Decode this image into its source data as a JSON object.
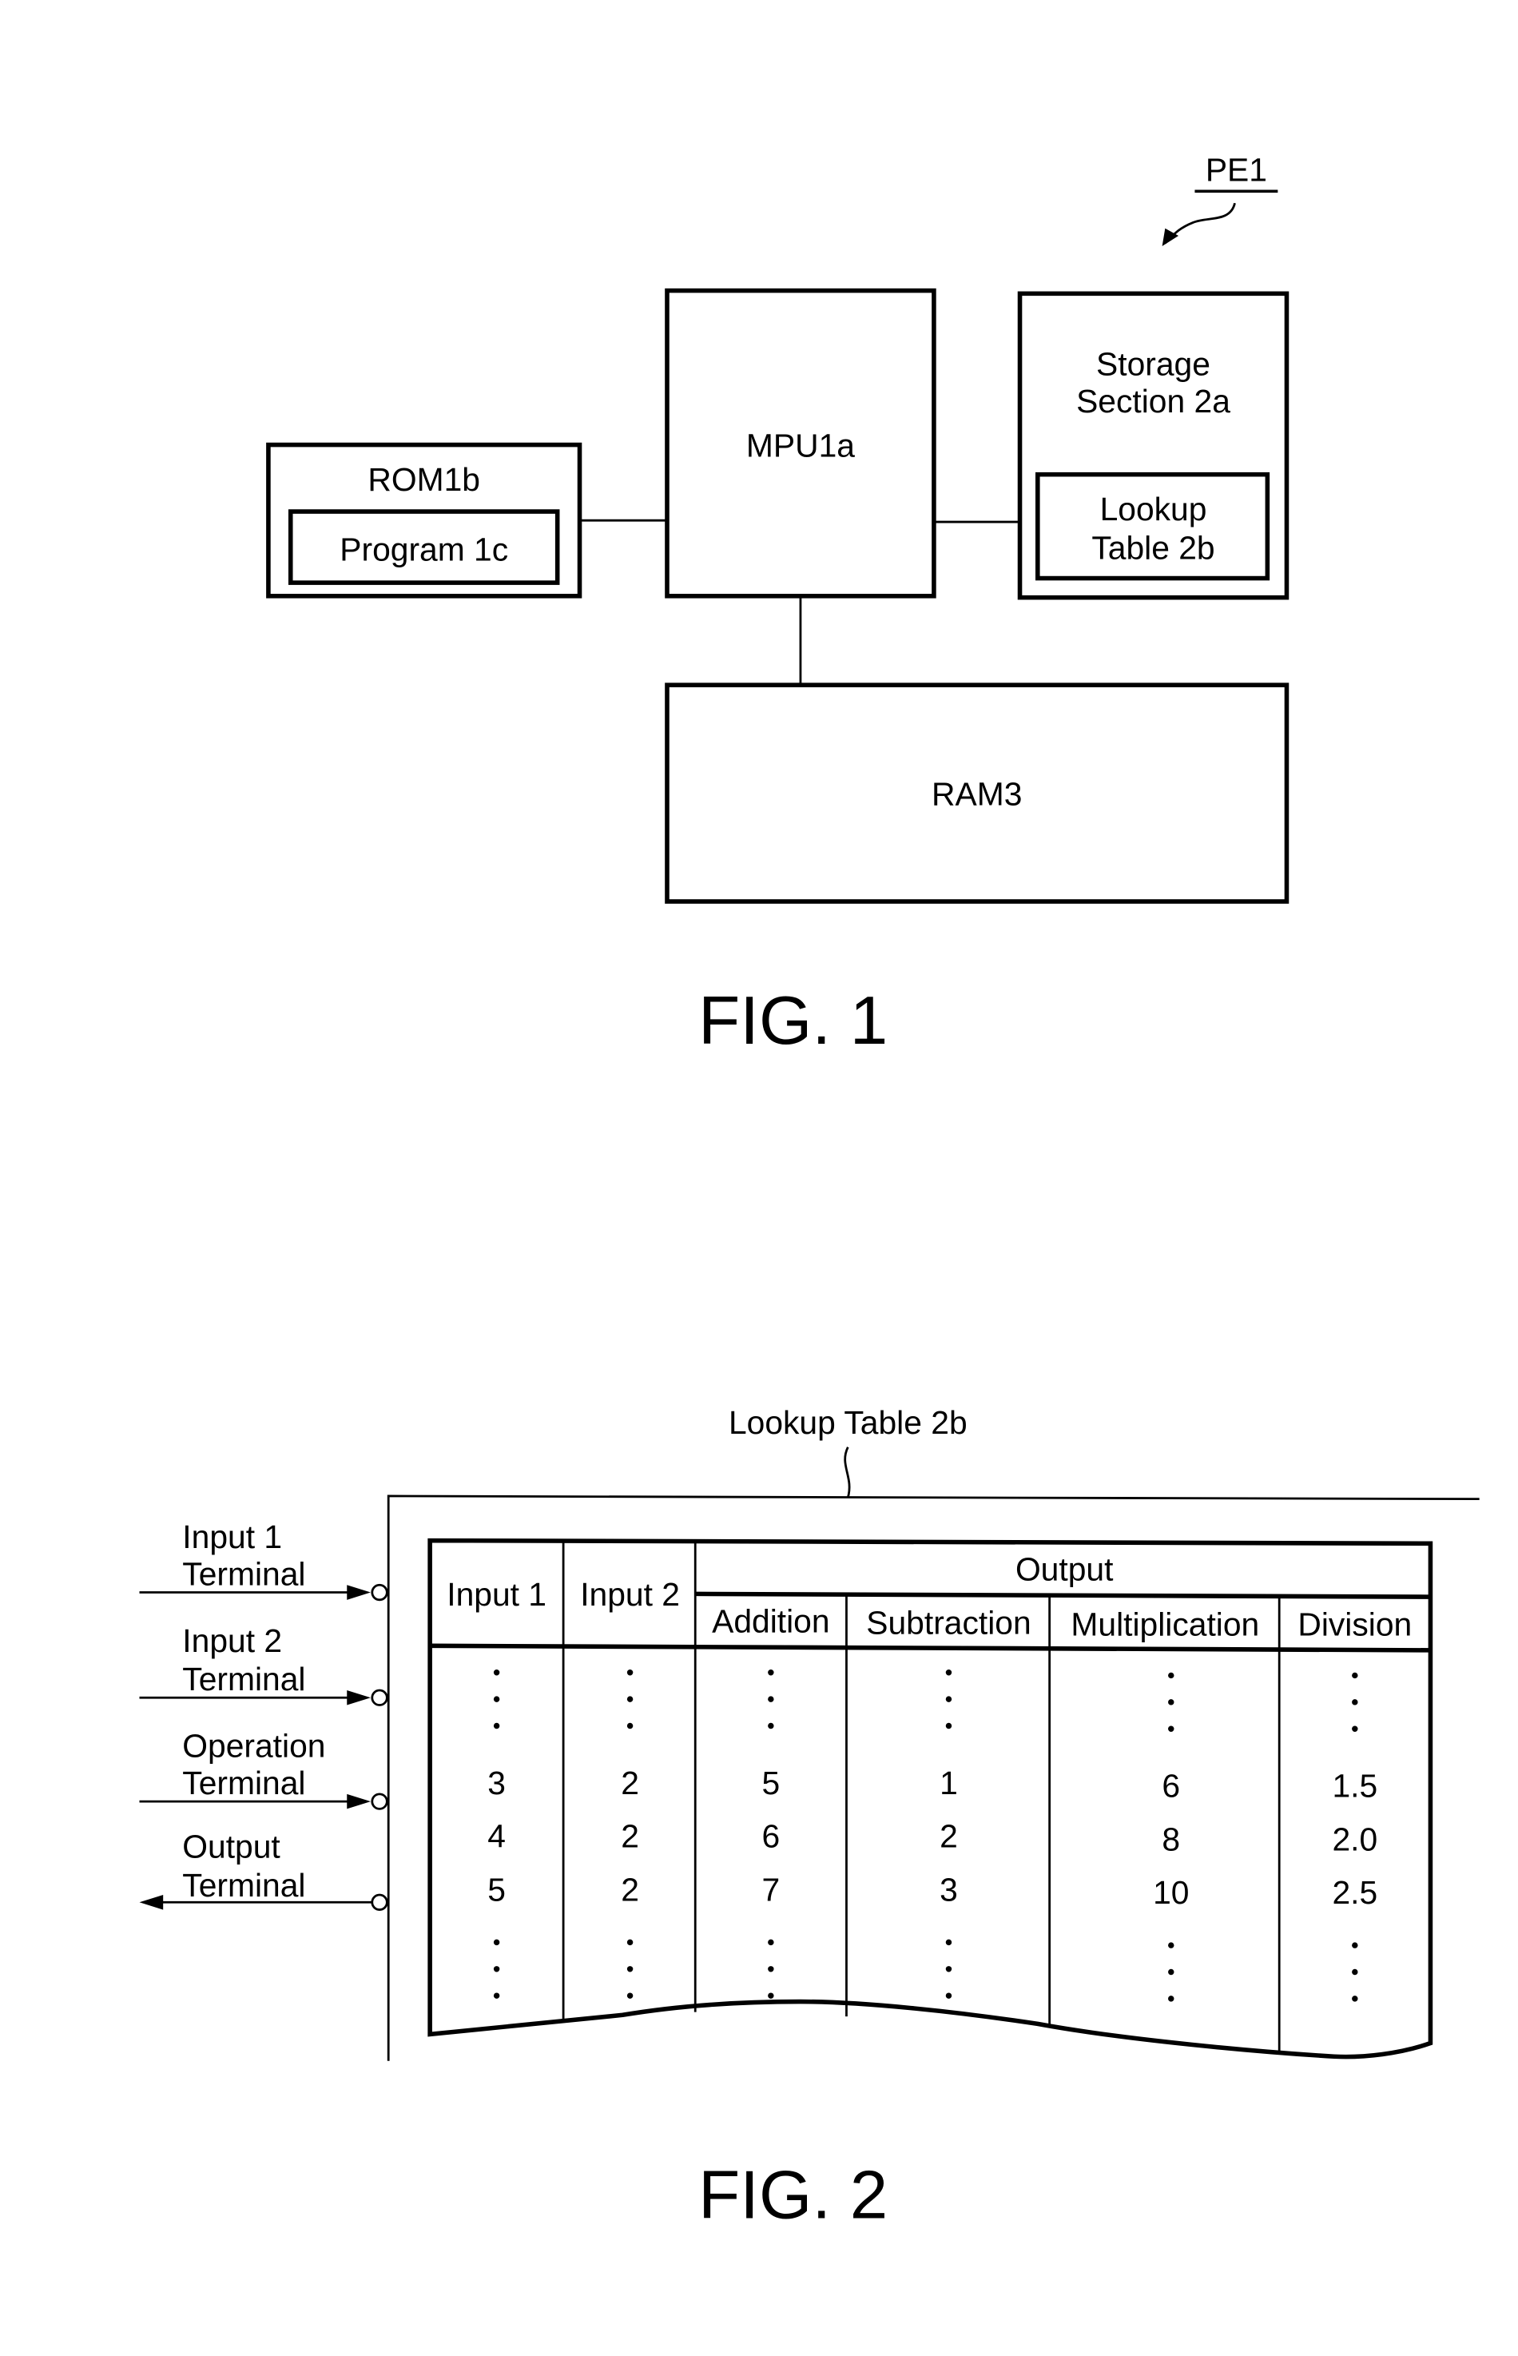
{
  "fig1": {
    "reference_label": "PE1",
    "blocks": {
      "rom": "ROM1b",
      "program": "Program 1c",
      "mpu": "MPU1a",
      "storage_line1": "Storage",
      "storage_line2": "Section 2a",
      "lookup_line1": "Lookup",
      "lookup_line2": "Table 2b",
      "ram": "RAM3"
    },
    "caption": "FIG. 1"
  },
  "fig2": {
    "table_label": "Lookup Table 2b",
    "terminals": [
      {
        "line1": "Input 1",
        "line2": "Terminal",
        "direction": "in"
      },
      {
        "line1": "Input 2",
        "line2": "Terminal",
        "direction": "in"
      },
      {
        "line1": "Operation",
        "line2": "Terminal",
        "direction": "in"
      },
      {
        "line1": "Output",
        "line2": "Terminal",
        "direction": "out"
      }
    ],
    "headers": {
      "input1": "Input 1",
      "input2": "Input 2",
      "output": "Output",
      "addition": "Addition",
      "subtraction": "Subtraction",
      "multiplication": "Multiplication",
      "division": "Division"
    },
    "ellipsis": "⋮",
    "rows": [
      [
        "3",
        "2",
        "5",
        "1",
        "6",
        "1.5"
      ],
      [
        "4",
        "2",
        "6",
        "2",
        "8",
        "2.0"
      ],
      [
        "5",
        "2",
        "7",
        "3",
        "10",
        "2.5"
      ]
    ],
    "caption": "FIG. 2"
  }
}
